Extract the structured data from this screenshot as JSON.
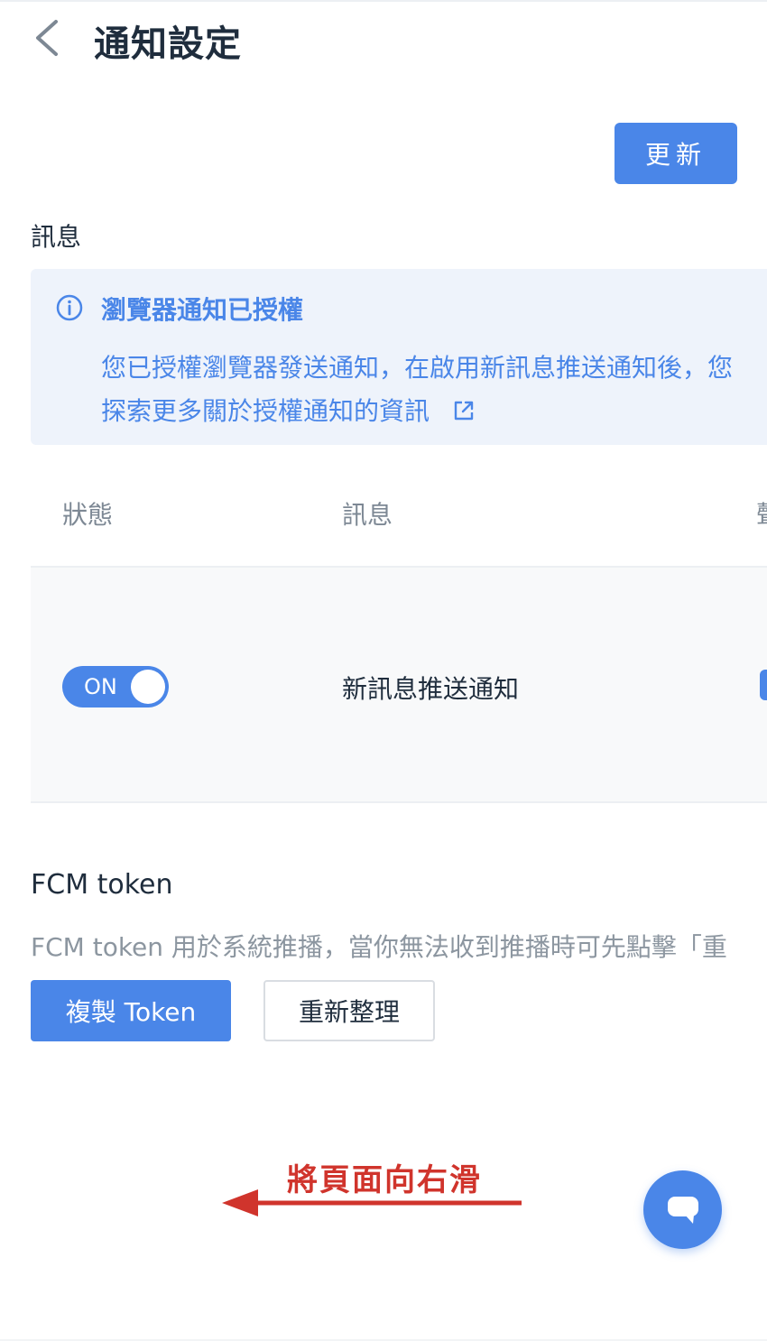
{
  "header": {
    "title": "通知設定",
    "back_icon": "chevron-left-icon"
  },
  "toolbar": {
    "refresh_label": "更新"
  },
  "messages_section": {
    "label": "訊息",
    "alert": {
      "icon": "info-icon",
      "title": "瀏覽器通知已授權",
      "body": "您已授權瀏覽器發送通知，在啟用新訊息推送通知後，您",
      "link_text": "探索更多關於授權通知的資訊",
      "link_icon": "external-link-icon"
    },
    "table": {
      "columns": [
        "狀態",
        "訊息",
        "聲"
      ],
      "rows": [
        {
          "toggle_label": "ON",
          "toggle_on": true,
          "message": "新訊息推送通知"
        }
      ]
    }
  },
  "fcm": {
    "title": "FCM token",
    "description": "FCM token 用於系統推播，當你無法收到推播時可先點擊「重",
    "copy_label": "複製 Token",
    "reload_label": "重新整理"
  },
  "annotation": {
    "text": "將頁面向右滑",
    "color": "#d0342c"
  },
  "chat_fab": {
    "icon": "chat-bubble-icon"
  },
  "colors": {
    "accent": "#4a86e8",
    "alert_bg": "#eef3fb",
    "annotation": "#d0342c"
  }
}
